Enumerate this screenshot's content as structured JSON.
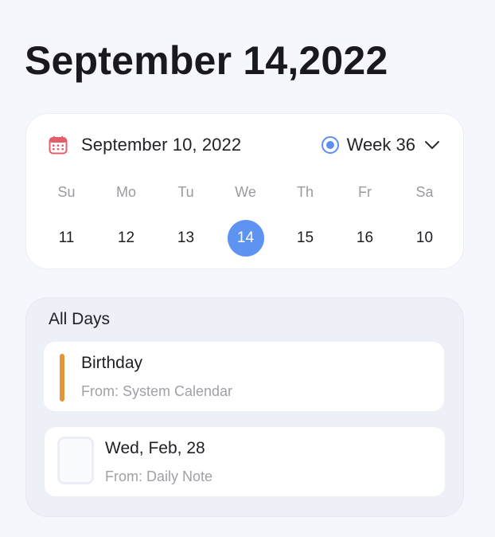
{
  "page": {
    "title": "September 14,2022"
  },
  "calendar": {
    "header_date": "September 10, 2022",
    "week_label": "Week 36",
    "icon": "calendar-icon",
    "accent_color": "#5e93f2",
    "days": [
      {
        "dow": "Su",
        "num": "11"
      },
      {
        "dow": "Mo",
        "num": "12"
      },
      {
        "dow": "Tu",
        "num": "13"
      },
      {
        "dow": "We",
        "num": "14",
        "selected": true
      },
      {
        "dow": "Th",
        "num": "15"
      },
      {
        "dow": "Fr",
        "num": "16"
      },
      {
        "dow": "Sa",
        "num": "10"
      }
    ]
  },
  "events": {
    "title": "All Days",
    "items": [
      {
        "title": "Birthday",
        "source": "From: System Calendar",
        "accent": "#e4953a"
      },
      {
        "title": "Wed, Feb, 28",
        "source": "From: Daily Note",
        "icon": "note-icon"
      }
    ]
  }
}
